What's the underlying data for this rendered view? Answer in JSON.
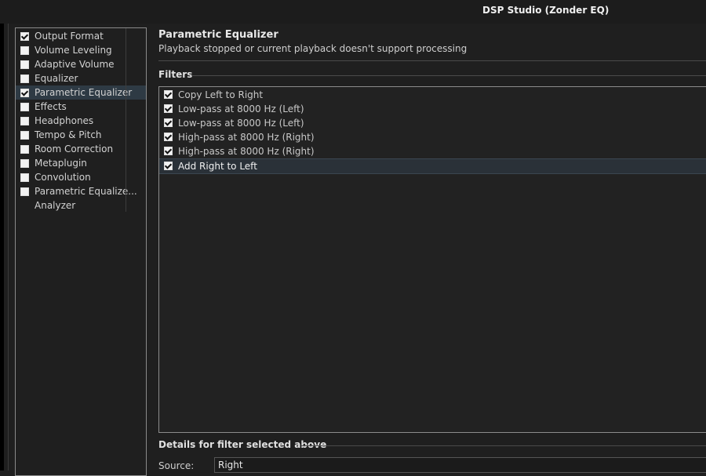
{
  "window": {
    "title": "DSP Studio (Zonder EQ)"
  },
  "sidebar": {
    "items": [
      {
        "label": "Output Format",
        "checkbox": true,
        "checked": true,
        "selected": false
      },
      {
        "label": "Volume Leveling",
        "checkbox": true,
        "checked": false,
        "selected": false
      },
      {
        "label": "Adaptive Volume",
        "checkbox": true,
        "checked": false,
        "selected": false
      },
      {
        "label": "Equalizer",
        "checkbox": true,
        "checked": false,
        "selected": false
      },
      {
        "label": "Parametric Equalizer",
        "checkbox": true,
        "checked": true,
        "selected": true
      },
      {
        "label": "Effects",
        "checkbox": true,
        "checked": false,
        "selected": false
      },
      {
        "label": "Headphones",
        "checkbox": true,
        "checked": false,
        "selected": false
      },
      {
        "label": "Tempo & Pitch",
        "checkbox": true,
        "checked": false,
        "selected": false
      },
      {
        "label": "Room Correction",
        "checkbox": true,
        "checked": false,
        "selected": false
      },
      {
        "label": "Metaplugin",
        "checkbox": true,
        "checked": false,
        "selected": false
      },
      {
        "label": "Convolution",
        "checkbox": true,
        "checked": false,
        "selected": false
      },
      {
        "label": "Parametric Equalize...",
        "checkbox": true,
        "checked": false,
        "selected": false
      },
      {
        "label": "Analyzer",
        "checkbox": false,
        "checked": false,
        "selected": false
      }
    ]
  },
  "panel": {
    "title": "Parametric Equalizer",
    "subtitle": "Playback stopped or current playback doesn't support processing",
    "filters_heading": "Filters",
    "filters": [
      {
        "label": "Copy Left to Right",
        "checked": true,
        "selected": false
      },
      {
        "label": "Low-pass at 8000 Hz (Left)",
        "checked": true,
        "selected": false
      },
      {
        "label": "Low-pass at 8000 Hz (Left)",
        "checked": true,
        "selected": false
      },
      {
        "label": "High-pass at 8000 Hz (Right)",
        "checked": true,
        "selected": false
      },
      {
        "label": "High-pass at 8000 Hz (Right)",
        "checked": true,
        "selected": false
      },
      {
        "label": "Add Right to Left",
        "checked": true,
        "selected": true
      }
    ],
    "details_heading": "Details for filter selected above",
    "source_label": "Source:",
    "source_value": "Right"
  }
}
